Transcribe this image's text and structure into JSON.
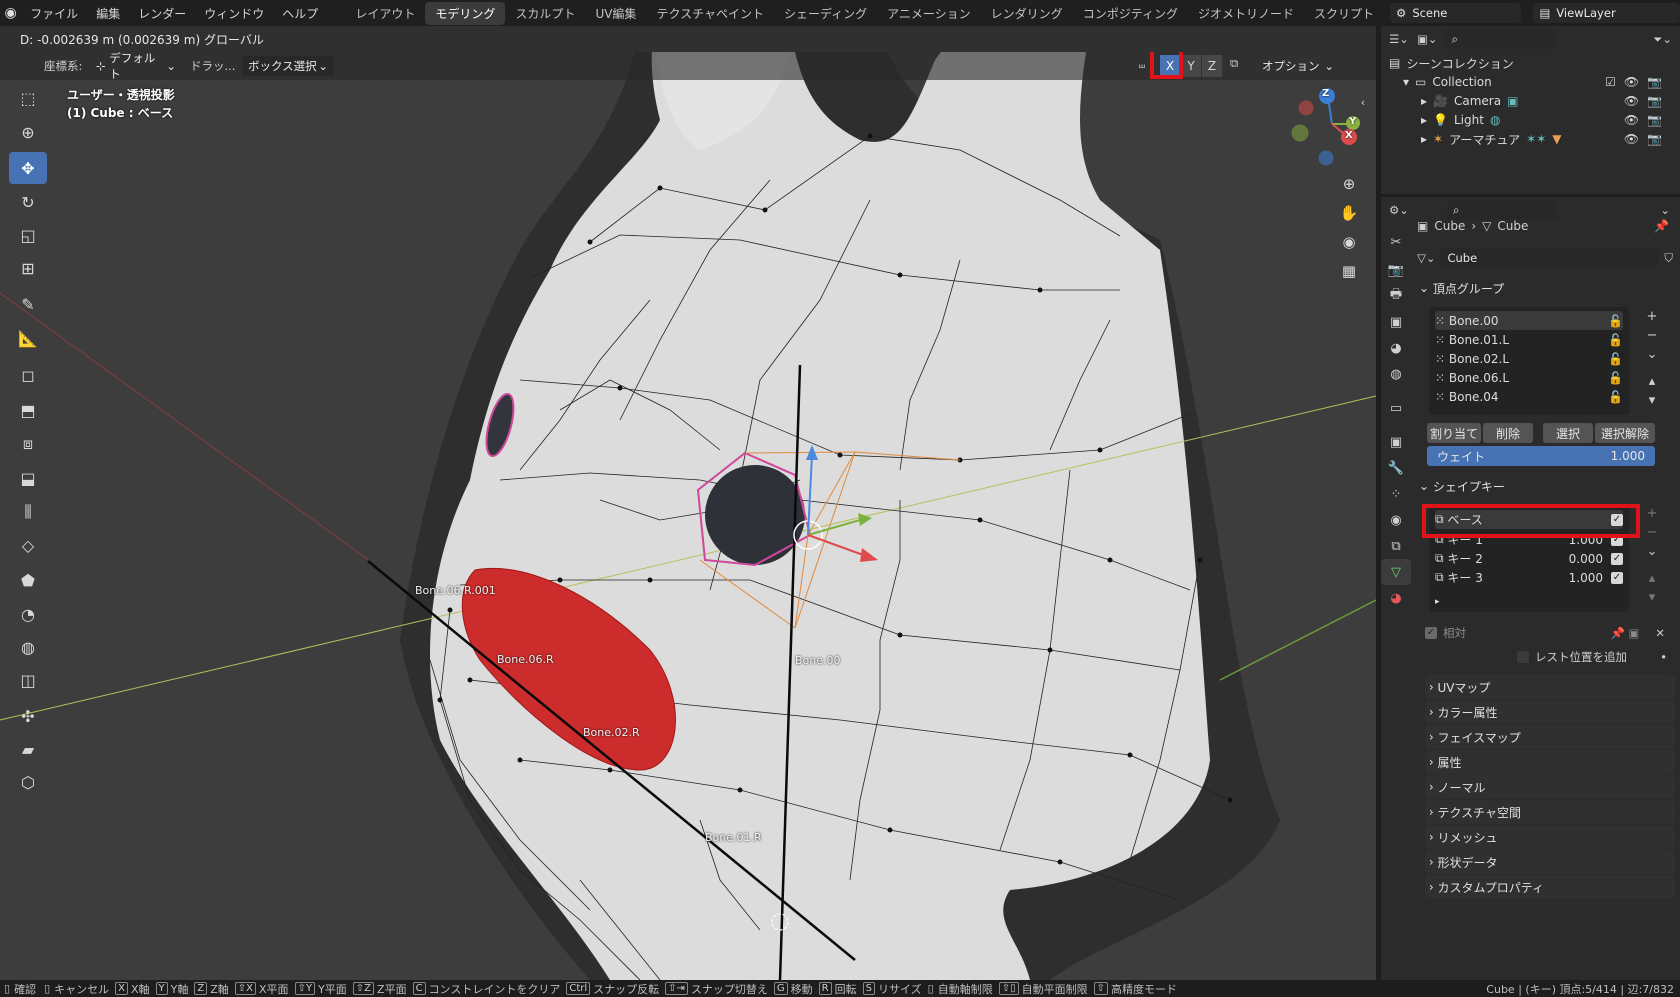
{
  "menubar": {
    "items": [
      "ファイル",
      "編集",
      "レンダー",
      "ウィンドウ",
      "ヘルプ"
    ]
  },
  "workspaces": {
    "tabs": [
      "レイアウト",
      "モデリング",
      "スカルプト",
      "UV編集",
      "テクスチャペイント",
      "シェーディング",
      "アニメーション",
      "レンダリング",
      "コンポジティング",
      "ジオメトリノード",
      "スクリプト"
    ],
    "active": "モデリング"
  },
  "scene": {
    "label": "Scene"
  },
  "viewlayer": {
    "label": "ViewLayer"
  },
  "header": {
    "status": "D: -0.002639 m (0.002639 m) グローバル"
  },
  "viewport_header": {
    "coord_label": "座標系:",
    "coord_value": "デフォルト",
    "drag_label": "ドラッ...",
    "select_mode": "ボックス選択",
    "axis_x": "X",
    "axis_y": "Y",
    "axis_z": "Z",
    "options": "オプション"
  },
  "overlay": {
    "view_name": "ユーザー・透視投影",
    "object_info": "(1) Cube : ベース"
  },
  "bones": {
    "b1": "Bone.06.R.001",
    "b2": "Bone.06.R",
    "b3": "Bone.02.R",
    "b4": "Bone.00",
    "b5": "Bone.01.R"
  },
  "gizmo": {
    "x": "X",
    "y": "Y",
    "z": "Z"
  },
  "outliner": {
    "root": "シーンコレクション",
    "collection": "Collection",
    "items": [
      "Camera",
      "Light",
      "アーマチュア"
    ]
  },
  "properties": {
    "breadcrumb_obj": "Cube",
    "breadcrumb_data": "Cube",
    "mesh_name": "Cube",
    "vertex_groups_title": "頂点グループ",
    "vertex_groups": [
      "Bone.00",
      "Bone.01.L",
      "Bone.02.L",
      "Bone.06.L",
      "Bone.04"
    ],
    "assign": "割り当て",
    "remove": "削除",
    "select": "選択",
    "deselect": "選択解除",
    "weight_label": "ウェイト",
    "weight_value": "1.000",
    "shape_keys_title": "シェイプキー",
    "shape_keys": [
      {
        "name": "ベース",
        "value": ""
      },
      {
        "name": "キー 1",
        "value": "1.000"
      },
      {
        "name": "キー 2",
        "value": "0.000"
      },
      {
        "name": "キー 3",
        "value": "1.000"
      }
    ],
    "relative": "相対",
    "add_rest": "レスト位置を追加",
    "collapsed_panels": [
      "UVマップ",
      "カラー属性",
      "フェイスマップ",
      "属性",
      "ノーマル",
      "テクスチャ空間",
      "リメッシュ",
      "形状データ",
      "カスタムプロパティ"
    ]
  },
  "statusbar": {
    "items": [
      [
        "",
        "確認"
      ],
      [
        "",
        "キャンセル"
      ],
      [
        "X",
        "X軸"
      ],
      [
        "Y",
        "Y軸"
      ],
      [
        "Z",
        "Z軸"
      ],
      [
        "⇧X",
        "X平面"
      ],
      [
        "⇧Y",
        "Y平面"
      ],
      [
        "⇧Z",
        "Z平面"
      ],
      [
        "C",
        "コンストレイントをクリア"
      ],
      [
        "Ctrl",
        "スナップ反転"
      ],
      [
        "",
        "スナップ切替え"
      ],
      [
        "G",
        "移動"
      ],
      [
        "R",
        "回転"
      ],
      [
        "S",
        "リサイズ"
      ],
      [
        "",
        "自動軸制限"
      ],
      [
        "",
        "自動平面制限"
      ],
      [
        "",
        "高精度モード"
      ]
    ],
    "right": "Cube | (キー) 頂点:5/414 | 辺:7/832"
  },
  "colors": {
    "accent": "#4772b3",
    "highlight_box": "#e2121b",
    "vertex_group_active_bg": "#3a3a3a"
  }
}
